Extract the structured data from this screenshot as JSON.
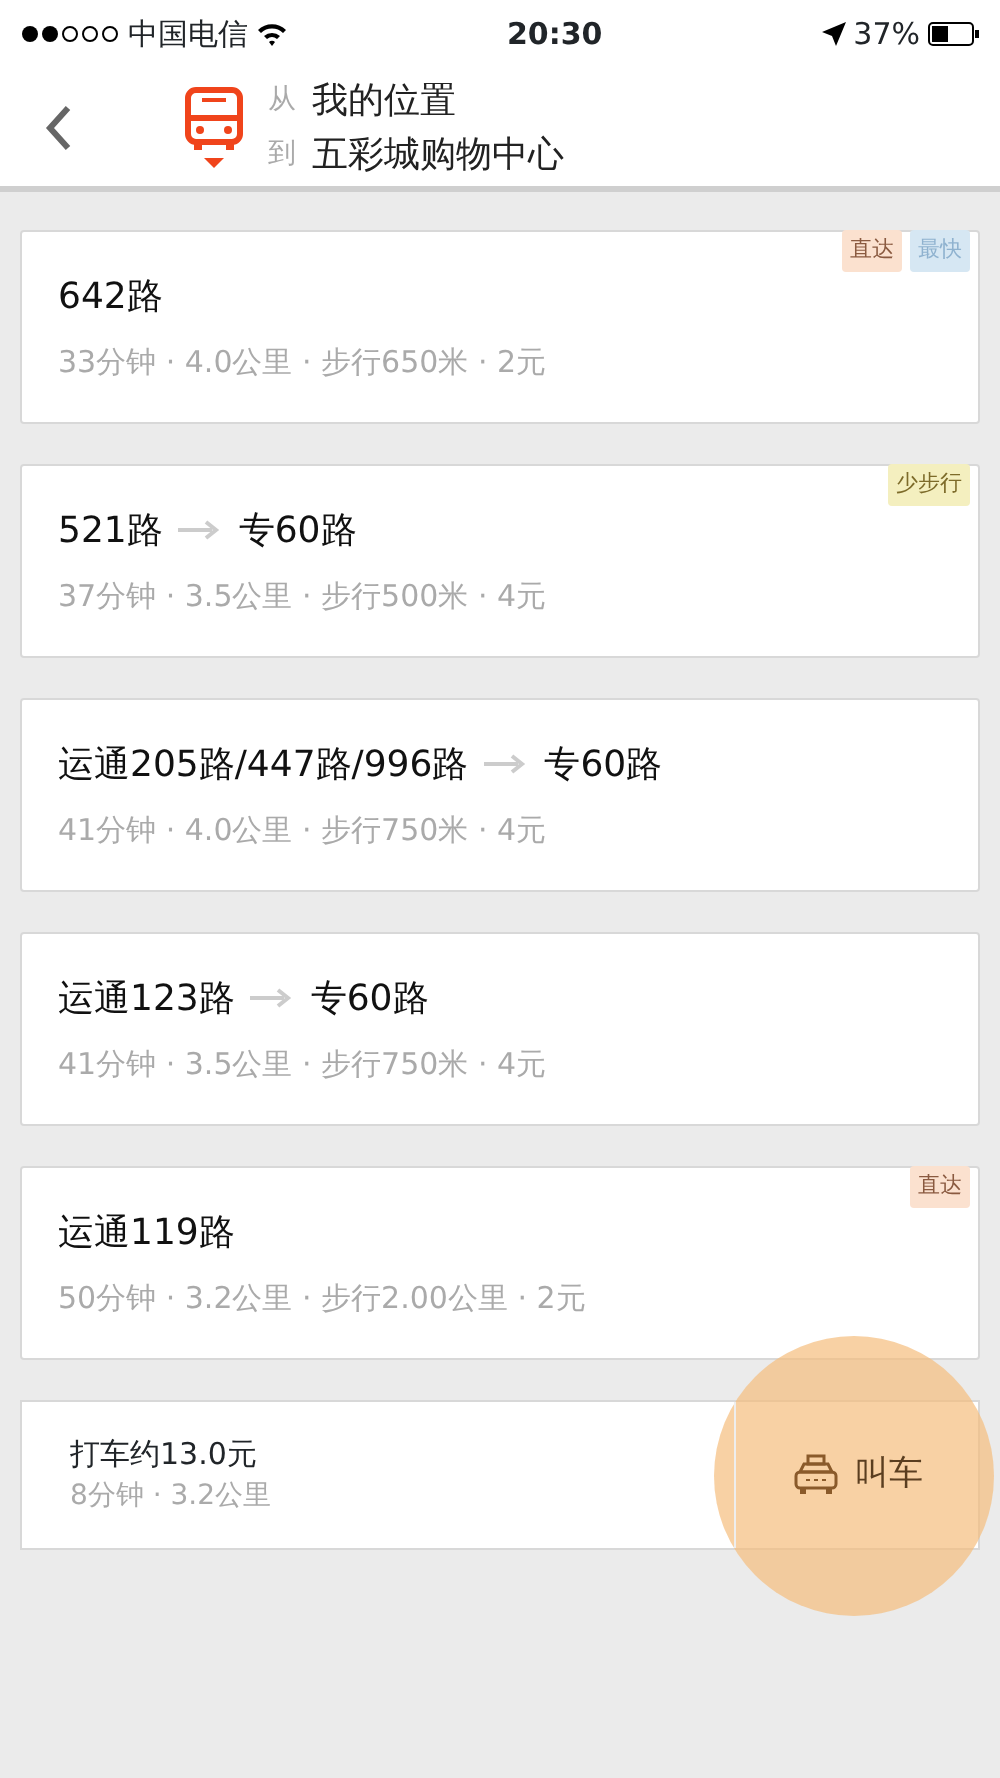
{
  "status_bar": {
    "carrier": "中国电信",
    "time": "20:30",
    "battery": "37%"
  },
  "header": {
    "from_label": "从",
    "from": "我的位置",
    "to_label": "到",
    "to": "五彩城购物中心"
  },
  "routes": [
    {
      "legs": [
        "642路"
      ],
      "meta": "33分钟 · 4.0公里 · 步行650米 · 2元",
      "tags": [
        {
          "kind": "direct",
          "text": "直达"
        },
        {
          "kind": "fastest",
          "text": "最快"
        }
      ]
    },
    {
      "legs": [
        "521路",
        "专60路"
      ],
      "meta": "37分钟 · 3.5公里 · 步行500米 · 4元",
      "tags": [
        {
          "kind": "less-walk",
          "text": "少步行"
        }
      ]
    },
    {
      "legs": [
        "运通205路/447路/996路",
        "专60路"
      ],
      "meta": "41分钟 · 4.0公里 · 步行750米 · 4元"
    },
    {
      "legs": [
        "运通123路",
        "专60路"
      ],
      "meta": "41分钟 · 3.5公里 · 步行750米 · 4元"
    },
    {
      "legs": [
        "运通119路"
      ],
      "meta": "50分钟 · 3.2公里 · 步行2.00公里 · 2元",
      "tags": [
        {
          "kind": "direct",
          "text": "直达"
        }
      ]
    }
  ],
  "taxi": {
    "title": "打车约13.0元",
    "meta": "8分钟 · 3.2公里",
    "button": "叫车"
  }
}
